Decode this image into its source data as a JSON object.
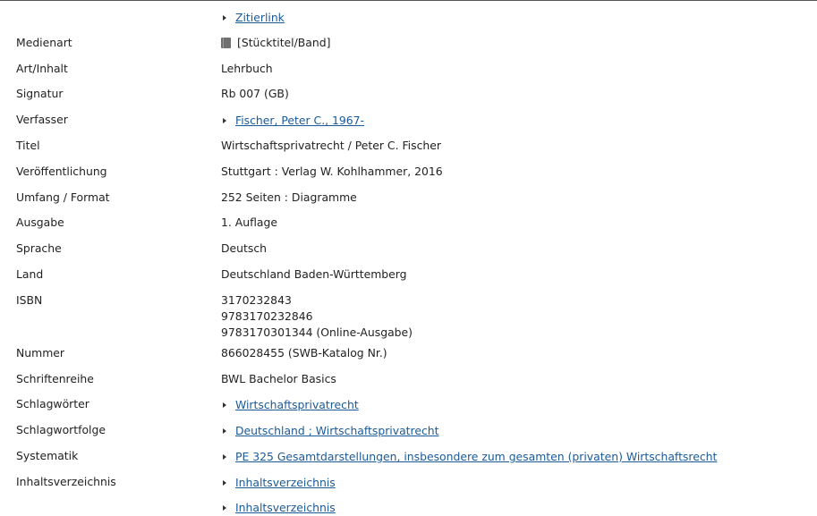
{
  "record": {
    "citation_link": "Zitierlink",
    "rows": [
      {
        "key": "medienart",
        "label": "Medienart",
        "value": "[Stücktitel/Band]",
        "icon": "book-icon"
      },
      {
        "key": "art",
        "label": "Art/Inhalt",
        "value": "Lehrbuch"
      },
      {
        "key": "signatur",
        "label": "Signatur",
        "value": "Rb 007 (GB)"
      },
      {
        "key": "verfasser",
        "label": "Verfasser",
        "link": "Fischer, Peter C., 1967-"
      },
      {
        "key": "titel",
        "label": "Titel",
        "value": "Wirtschaftsprivatrecht / Peter C. Fischer"
      },
      {
        "key": "veroeffentlichung",
        "label": "Veröffentlichung",
        "value": "Stuttgart : Verlag W. Kohlhammer, 2016"
      },
      {
        "key": "umfang",
        "label": "Umfang / Format",
        "value": "252 Seiten : Diagramme"
      },
      {
        "key": "ausgabe",
        "label": "Ausgabe",
        "value": "1. Auflage"
      },
      {
        "key": "sprache",
        "label": "Sprache",
        "value": "Deutsch"
      },
      {
        "key": "land",
        "label": "Land",
        "value": "Deutschland Baden-Württemberg"
      },
      {
        "key": "isbn",
        "label": "ISBN",
        "values": [
          "3170232843",
          "9783170232846",
          "9783170301344 (Online-Ausgabe)"
        ]
      },
      {
        "key": "nummer",
        "label": "Nummer",
        "value": "866028455 (SWB-Katalog Nr.)"
      },
      {
        "key": "schriftenreihe",
        "label": "Schriftenreihe",
        "value": "BWL Bachelor Basics"
      },
      {
        "key": "schlagwoerter",
        "label": "Schlagwörter",
        "link": "Wirtschaftsprivatrecht"
      },
      {
        "key": "schlagwortfolge",
        "label": "Schlagwortfolge",
        "link": "Deutschland ; Wirtschaftsprivatrecht"
      },
      {
        "key": "systematik",
        "label": "Systematik",
        "link": "PE 325 Gesamtdarstellungen, insbesondere zum gesamten (privaten) Wirtschaftsrecht"
      },
      {
        "key": "inhaltsverzeichnis",
        "label": "Inhaltsverzeichnis",
        "links": [
          "Inhaltsverzeichnis",
          "Inhaltsverzeichnis"
        ]
      }
    ]
  }
}
